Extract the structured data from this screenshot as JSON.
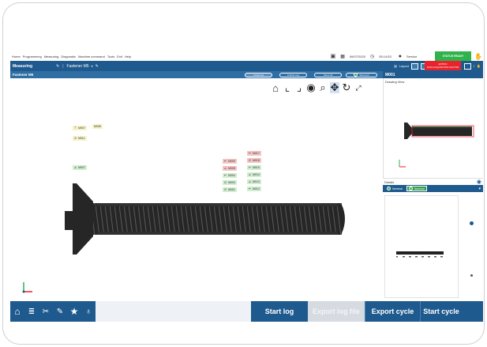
{
  "menubar": {
    "items": [
      "Home",
      "Programming",
      "Measuring",
      "Diagnostic",
      "Machine command",
      "Tools",
      "Exit",
      "Help"
    ],
    "date": "06/07/2020",
    "time": "05:14:53",
    "user": "Service",
    "status_ready": "STATUS READY",
    "status_stop_line1": "EXTRA!",
    "status_stop_line2": "DATA ACQUISITION FACTOR"
  },
  "toolbar": {
    "section": "Measuring",
    "program": "Fastener M5",
    "layout_label": "Layout"
  },
  "subheader": {
    "title": "Fastener M5",
    "pill1": "Advanced",
    "pill2": "Critical only",
    "pill3": "Show All",
    "pill4": "Start part"
  },
  "right_panel": {
    "header": "M001",
    "drawing_label": "Drawing View",
    "details_label": "Details",
    "tab1": "Nominal",
    "tab2": "Nominal"
  },
  "tags": [
    {
      "label": "M007",
      "color": "y"
    },
    {
      "label": "M008",
      "color": "y"
    },
    {
      "label": "M011",
      "color": "y"
    },
    {
      "label": "M007",
      "color": "g"
    },
    {
      "label": "M017",
      "color": "r"
    },
    {
      "label": "M009",
      "color": "r"
    },
    {
      "label": "M018",
      "color": "r"
    },
    {
      "label": "M005",
      "color": "r"
    },
    {
      "label": "M015",
      "color": "g"
    },
    {
      "label": "M004",
      "color": "g"
    },
    {
      "label": "M014",
      "color": "g"
    },
    {
      "label": "M003",
      "color": "g"
    },
    {
      "label": "M013",
      "color": "g"
    },
    {
      "label": "M001",
      "color": "g"
    },
    {
      "label": "M012",
      "color": "g"
    }
  ],
  "bottom": {
    "start_log": "Start log",
    "export_log": "Export log file",
    "export_cycle": "Export cycle",
    "start_cycle": "Start cycle"
  },
  "colors": {
    "primary_blue": "#1f5a8e",
    "ready_green": "#2fb34a",
    "stop_red": "#e8232b"
  }
}
